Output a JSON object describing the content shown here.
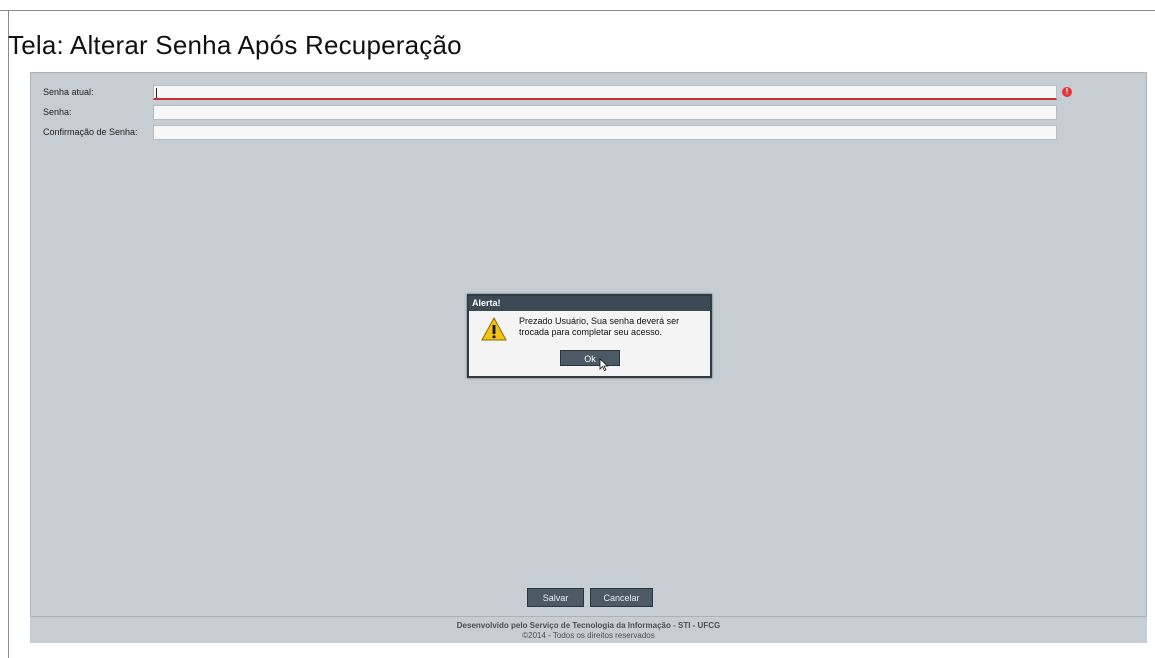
{
  "page": {
    "title": "Tela: Alterar Senha Após Recuperação"
  },
  "form": {
    "fields": [
      {
        "label": "Senha atual:",
        "value": ""
      },
      {
        "label": "Senha:",
        "value": ""
      },
      {
        "label": "Confirmação de Senha:",
        "value": ""
      }
    ]
  },
  "dialog": {
    "title": "Alerta!",
    "message": "Prezado Usuário, Sua senha deverá ser trocada para completar seu acesso.",
    "ok_label": "Ok",
    "icon": "warning-icon"
  },
  "actions": {
    "save_label": "Salvar",
    "cancel_label": "Cancelar"
  },
  "footer": {
    "line1": "Desenvolvido pelo Serviço de Tecnologia da Informação - STI - UFCG",
    "line2": "©2014 - Todos os direitos reservados"
  },
  "colors": {
    "app_background": "#c6ced3",
    "dialog_titlebar": "#3c4a55",
    "button": "#4b5a65",
    "error": "#e2363a"
  }
}
